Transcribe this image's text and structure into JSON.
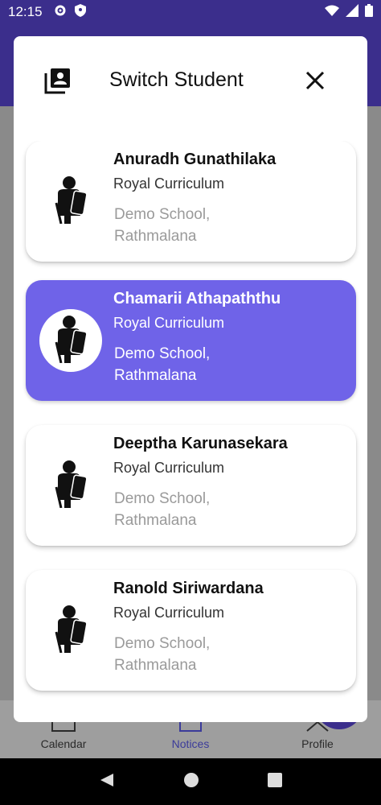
{
  "status_bar": {
    "time": "12:15"
  },
  "dialog": {
    "title": "Switch Student",
    "students": [
      {
        "name": "Anuradh Gunathilaka",
        "curriculum": "Royal Curriculum",
        "school_line1": "Demo School,",
        "school_line2": "Rathmalana",
        "selected": false
      },
      {
        "name": "Chamarii Athapaththu",
        "curriculum": "Royal Curriculum",
        "school_line1": "Demo School,",
        "school_line2": "Rathmalana",
        "selected": true
      },
      {
        "name": "Deeptha Karunasekara",
        "curriculum": "Royal Curriculum",
        "school_line1": "Demo School,",
        "school_line2": "Rathmalana",
        "selected": false
      },
      {
        "name": "Ranold Siriwardana",
        "curriculum": "Royal Curriculum",
        "school_line1": "Demo School,",
        "school_line2": "Rathmalana",
        "selected": false
      }
    ]
  },
  "bottom_nav": {
    "items": [
      {
        "label": "Calendar",
        "icon": "calendar-icon"
      },
      {
        "label": "Notices",
        "icon": "notices-icon"
      },
      {
        "label": "Profile",
        "icon": "profile-icon"
      }
    ]
  },
  "colors": {
    "primary": "#3b2e8c",
    "accent": "#6f63e8"
  }
}
